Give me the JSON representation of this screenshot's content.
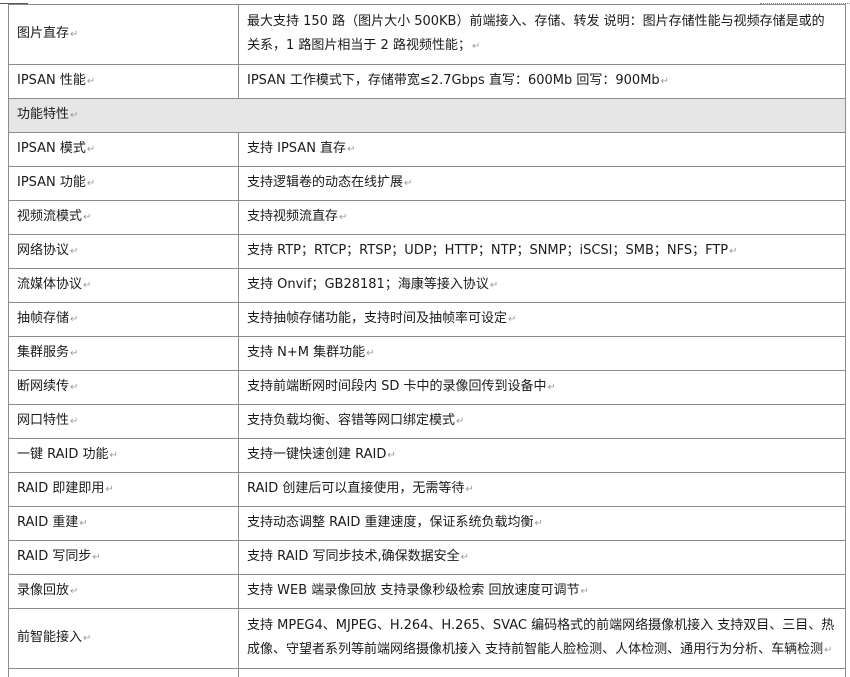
{
  "rows": [
    {
      "key": "图片直存",
      "value": "最大支持 150 路（图片大小 500KB）前端接入、存储、转发  说明：图片存储性能与视频存储是或的关系，1 路图片相当于 2 路视频性能；",
      "tall": true
    },
    {
      "key": "IPSAN 性能",
      "value": "IPSAN 工作模式下，存储带宽≤2.7Gbps  直写：600Mb  回写：900Mb"
    },
    {
      "section": "功能特性"
    },
    {
      "key": "IPSAN 模式",
      "value": "支持 IPSAN 直存"
    },
    {
      "key": "IPSAN 功能",
      "value": "支持逻辑卷的动态在线扩展"
    },
    {
      "key": "视频流模式",
      "value": "支持视频流直存"
    },
    {
      "key": "网络协议",
      "value": "支持 RTP；RTCP；RTSP；UDP；HTTP；NTP；SNMP；iSCSI；SMB；NFS；FTP"
    },
    {
      "key": "流媒体协议",
      "value": "支持 Onvif；GB28181；海康等接入协议"
    },
    {
      "key": "抽帧存储",
      "value": "支持抽帧存储功能，支持时间及抽帧率可设定"
    },
    {
      "key": "集群服务",
      "value": "支持 N+M 集群功能"
    },
    {
      "key": "断网续传",
      "value": "支持前端断网时间段内 SD 卡中的录像回传到设备中"
    },
    {
      "key": "网口特性",
      "value": "支持负载均衡、容错等网口绑定模式"
    },
    {
      "key": "一键 RAID 功能",
      "value": "支持一键快速创建 RAID"
    },
    {
      "key": "RAID 即建即用",
      "value": "RAID 创建后可以直接使用，无需等待"
    },
    {
      "key": "RAID 重建",
      "value": "支持动态调整 RAID 重建速度，保证系统负载均衡"
    },
    {
      "key": "RAID 写同步",
      "value": "支持 RAID 写同步技术,确保数据安全"
    },
    {
      "key": "录像回放",
      "value": "支持 WEB 端录像回放  支持录像秒级检索  回放速度可调节"
    },
    {
      "key": "前智能接入",
      "value": "支持 MPEG4、MJPEG、H.264、H.265、SVAC 编码格式的前端网络摄像机接入 支持双目、三目、热成像、守望者系列等前端网络摄像机接入 支持前智能人脸检测、人体检测、通用行为分析、车辆检测",
      "tall": true
    }
  ]
}
